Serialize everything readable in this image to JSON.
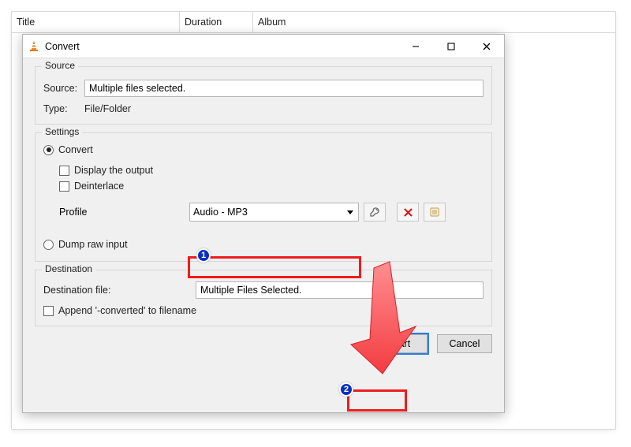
{
  "columns": {
    "title": "Title",
    "duration": "Duration",
    "album": "Album"
  },
  "dialog": {
    "title": "Convert",
    "source": {
      "group": "Source",
      "source_label": "Source:",
      "source_value": "Multiple files selected.",
      "type_label": "Type:",
      "type_value": "File/Folder"
    },
    "settings": {
      "group": "Settings",
      "convert_label": "Convert",
      "display_output": "Display the output",
      "deinterlace": "Deinterlace",
      "profile_label": "Profile",
      "profile_value": "Audio - MP3",
      "dump_label": "Dump raw input"
    },
    "dest": {
      "group": "Destination",
      "file_label": "Destination file:",
      "file_value": "Multiple Files Selected.",
      "append_label": "Append '-converted' to filename"
    },
    "buttons": {
      "start": "Start",
      "cancel": "Cancel"
    }
  },
  "badges": {
    "one": "1",
    "two": "2"
  }
}
